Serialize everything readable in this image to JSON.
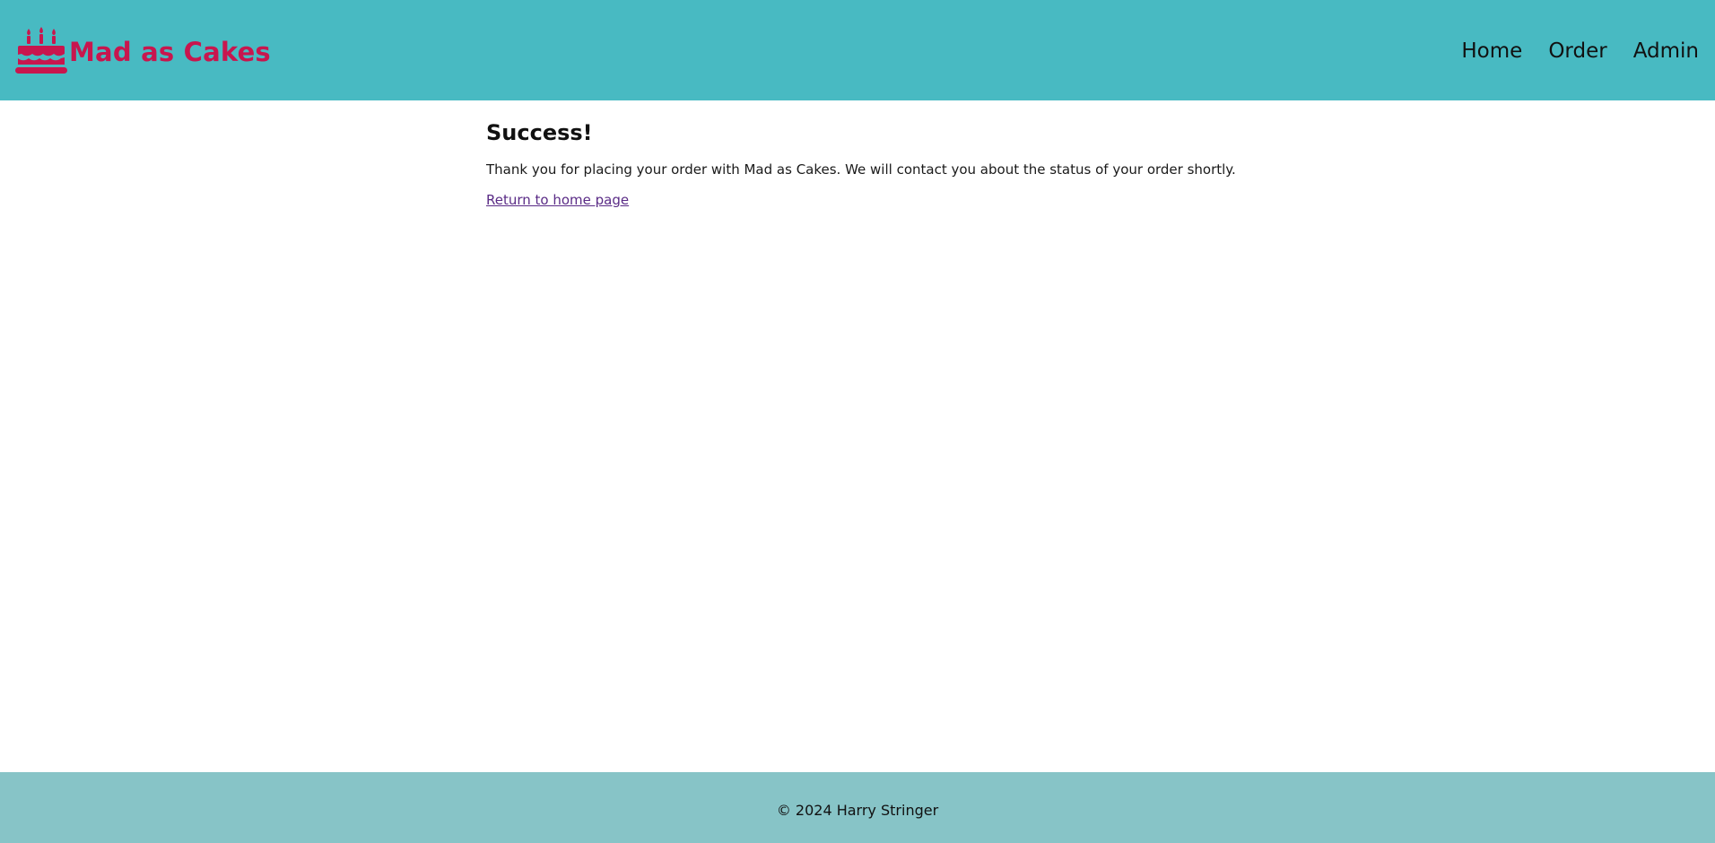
{
  "header": {
    "brand_name": "Mad as Cakes",
    "brand_icon": "cake-icon",
    "brand_color": "#c8164e",
    "background_color": "#48bac2",
    "nav": [
      {
        "label": "Home"
      },
      {
        "label": "Order"
      },
      {
        "label": "Admin"
      }
    ]
  },
  "main": {
    "heading": "Success!",
    "message": "Thank you for placing your order with Mad as Cakes. We will contact you about the status of your order shortly.",
    "home_link_label": "Return to home page"
  },
  "footer": {
    "text": "© 2024 Harry Stringer",
    "background_color": "#87c4c7"
  }
}
